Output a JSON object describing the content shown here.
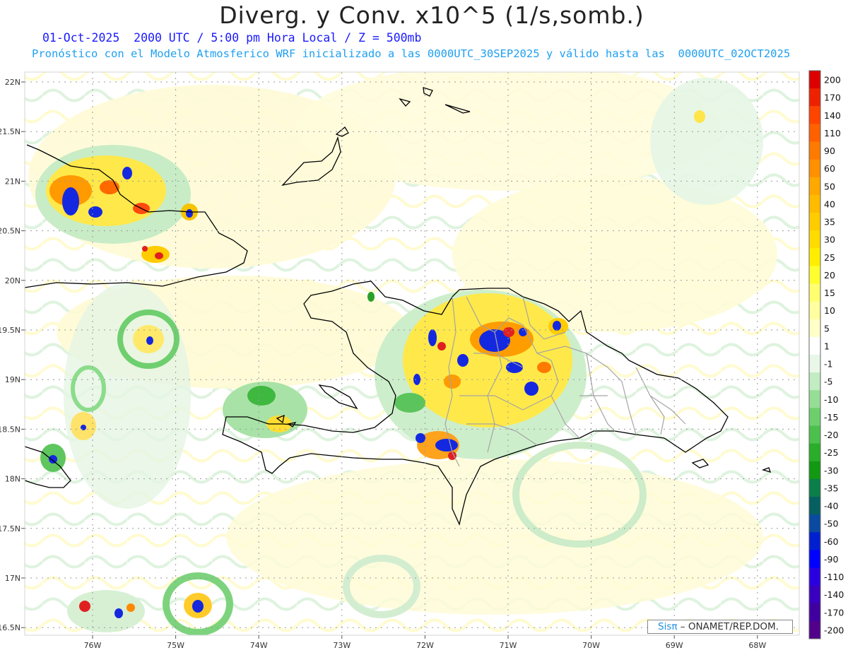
{
  "title": "Diverg. y Conv. x10^5 (1/s,somb.)",
  "subtitle_line1": "01-Oct-2025  2000 UTC / 5:00 pm Hora Local / Z = 500mb",
  "subtitle_line2": "Pronóstico con el Modelo Atmosferico WRF inicializado a las 0000UTC_30SEP2025 y válido hasta las  0000UTC_02OCT2025",
  "latitude_labels": [
    "22N",
    "21.5N",
    "21N",
    "20.5N",
    "20N",
    "19.5N",
    "19N",
    "18.5N",
    "18N",
    "17.5N",
    "17N",
    "16.5N"
  ],
  "longitude_labels": [
    "76W",
    "75W",
    "74W",
    "73W",
    "72W",
    "71W",
    "70W",
    "69W",
    "68W"
  ],
  "colorbar": {
    "labels": [
      "200",
      "170",
      "140",
      "110",
      "90",
      "60",
      "50",
      "40",
      "35",
      "30",
      "25",
      "20",
      "15",
      "10",
      "5",
      "1",
      "-1",
      "-5",
      "-10",
      "-15",
      "-20",
      "-25",
      "-30",
      "-35",
      "-40",
      "-50",
      "-60",
      "-90",
      "-110",
      "-140",
      "-170",
      "-200"
    ],
    "colors": [
      "#dd0000",
      "#ee2200",
      "#ff4400",
      "#ff6000",
      "#ff7a00",
      "#ff9000",
      "#ffa800",
      "#ffbb00",
      "#ffcc00",
      "#ffdc00",
      "#ffee00",
      "#ffff30",
      "#ffff70",
      "#ffffa0",
      "#ffffc8",
      "#ffffff",
      "#e8f7e8",
      "#c2ecc2",
      "#96dd96",
      "#6ccf6c",
      "#4cc04c",
      "#2aae2a",
      "#119a11",
      "#0a7f4a",
      "#066060",
      "#0a4aa0",
      "#0020d0",
      "#0000ff",
      "#2a00e0",
      "#3a00c0",
      "#4000a0",
      "#50008a"
    ]
  },
  "credit": {
    "brand": "Sisπ",
    "text": " – ONAMET/REP.DOM."
  }
}
